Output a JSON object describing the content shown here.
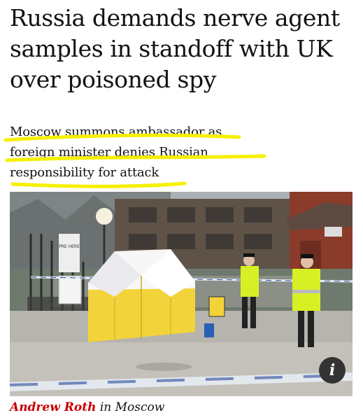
{
  "headline": "Russia demands nerve agent samples in standoff with UK over poisoned spy",
  "standfirst": {
    "line1": "Moscow summons ambassador as",
    "line2": "foreign minister denies Russian",
    "line3": "responsibility for attack"
  },
  "photo": {
    "info_label": "i",
    "sign_text": "PRE HERE"
  },
  "byline": {
    "author": "Andrew Roth",
    "location": "in Moscow"
  },
  "colors": {
    "author_red": "#c70000",
    "highlighter_yellow": "#f5f000",
    "tent_yellow": "#f2d43a",
    "hi_vis": "#d7f025"
  }
}
